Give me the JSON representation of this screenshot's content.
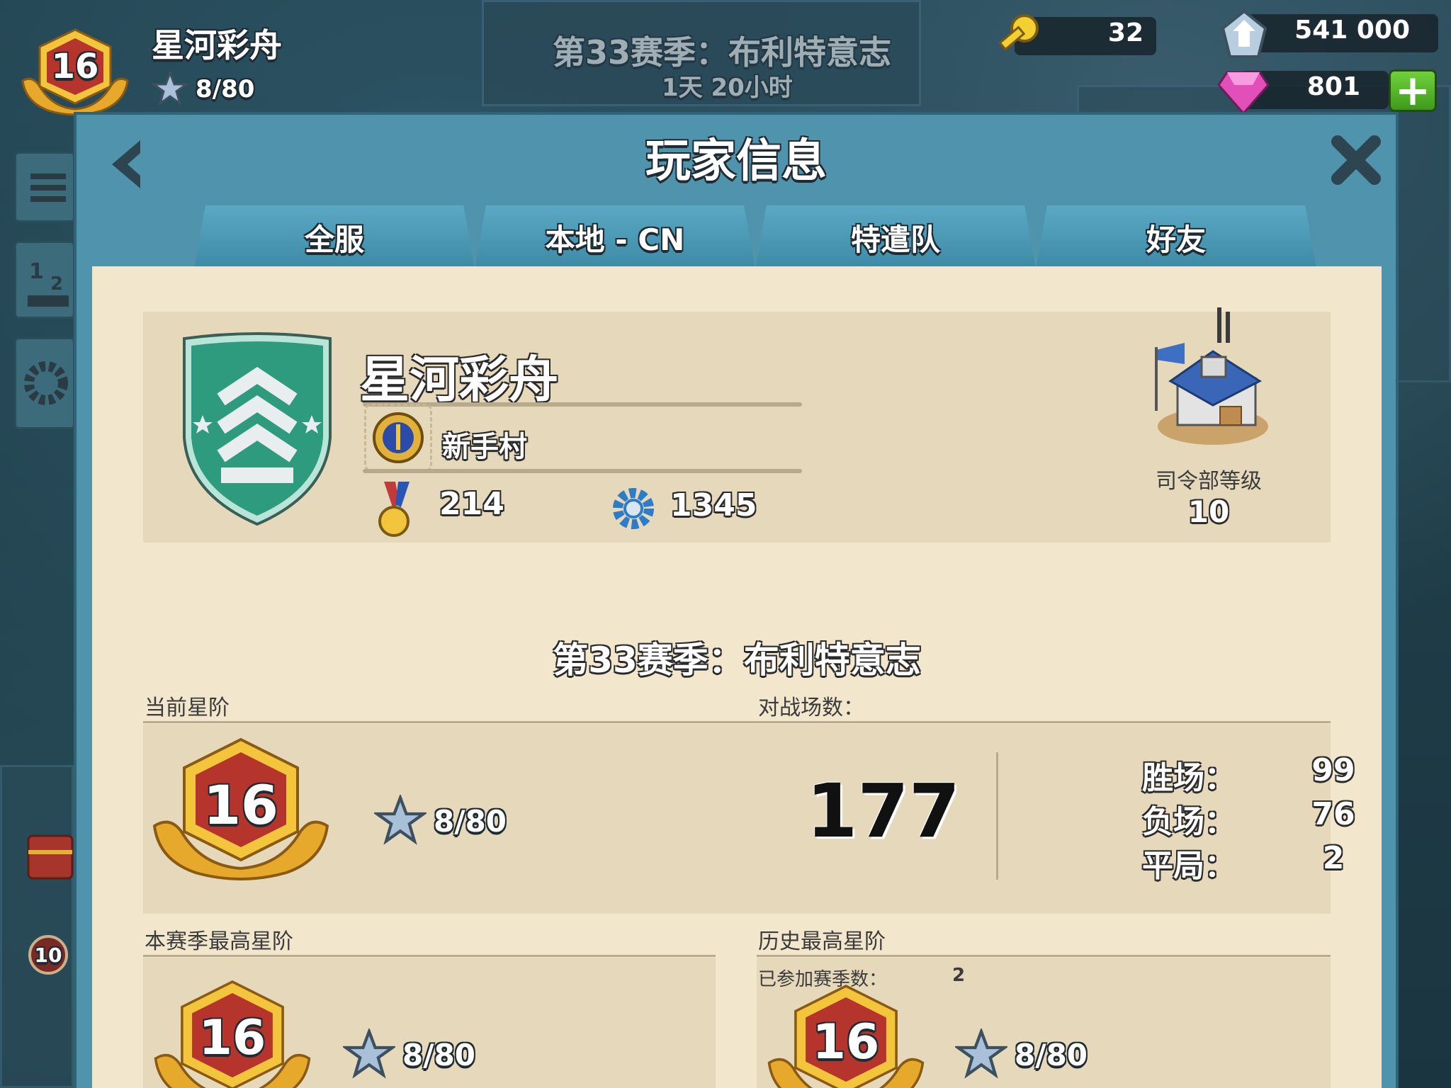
{
  "hud": {
    "level": "16",
    "player_name": "星河彩舟",
    "stars": "8/80",
    "season": "第33赛季：布利特意志",
    "timer": "1天 20小时",
    "keys": "32",
    "intel": "541 000",
    "diamonds": "801",
    "plus_label": "+"
  },
  "panel": {
    "title": "玩家信息",
    "tabs": [
      {
        "label": "全服"
      },
      {
        "label": "本地 - CN"
      },
      {
        "label": "特遣队"
      },
      {
        "label": "好友"
      }
    ]
  },
  "profile": {
    "name": "星河彩舟",
    "task_force": "新手村",
    "medals": "214",
    "victory_points": "1345",
    "hq_label": "司令部等级",
    "hq_level": "10"
  },
  "season": {
    "title": "第33赛季：布利特意志",
    "current_rank_label": "当前星阶",
    "battles_label": "对战场数：",
    "current_rank_level": "16",
    "current_stars": "8/80",
    "battles_total": "177",
    "wins_label": "胜场：",
    "wins": "99",
    "losses_label": "负场：",
    "losses": "76",
    "draws_label": "平局：",
    "draws": "2"
  },
  "best_season": {
    "label": "本赛季最高星阶",
    "level": "16",
    "stars": "8/80"
  },
  "history": {
    "label": "历史最高星阶",
    "seasons_label": "已参加赛季数：",
    "seasons_count": "2",
    "level": "16",
    "stars": "8/80"
  },
  "side": {
    "chest_badge": "10"
  },
  "colors": {
    "panel_blue": "#4f93ad",
    "paper": "#f2e6cc",
    "card": "#e6d8ba",
    "rank_red": "#b5342c",
    "rank_gold": "#e9b531"
  }
}
